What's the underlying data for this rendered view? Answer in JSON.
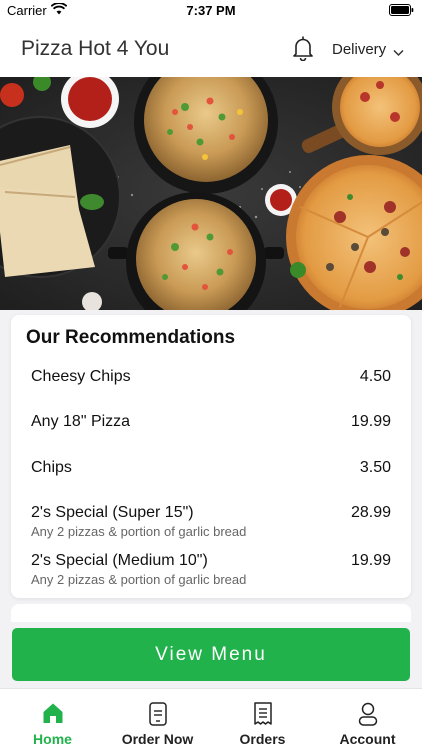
{
  "status_bar": {
    "carrier": "Carrier",
    "time": "7:37 PM"
  },
  "header": {
    "title": "Pizza Hot 4 You",
    "mode": "Delivery"
  },
  "recommendations": {
    "title": "Our Recommendations",
    "items": [
      {
        "name": "Cheesy Chips",
        "price": "4.50",
        "desc": ""
      },
      {
        "name": "Any 18\" Pizza",
        "price": "19.99",
        "desc": ""
      },
      {
        "name": "Chips",
        "price": "3.50",
        "desc": ""
      },
      {
        "name": "2's Special (Super 15\")",
        "price": "28.99",
        "desc": "Any 2 pizzas & portion of garlic bread"
      },
      {
        "name": "2's Special (Medium 10\")",
        "price": "19.99",
        "desc": "Any 2 pizzas & portion of garlic bread"
      }
    ]
  },
  "cta": {
    "label": "View Menu"
  },
  "tabs": [
    {
      "label": "Home",
      "icon": "home-icon",
      "active": true
    },
    {
      "label": "Order Now",
      "icon": "order-icon",
      "active": false
    },
    {
      "label": "Orders",
      "icon": "receipt-icon",
      "active": false
    },
    {
      "label": "Account",
      "icon": "user-icon",
      "active": false
    }
  ],
  "colors": {
    "accent": "#22b24c"
  }
}
